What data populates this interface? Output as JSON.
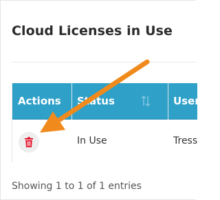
{
  "card": {
    "title": "Cloud Licenses in Use"
  },
  "table": {
    "columns": [
      "Actions",
      "Status",
      "User"
    ],
    "rows": [
      {
        "status": "In Use",
        "user": "Tress"
      }
    ]
  },
  "footer": {
    "info": "Showing 1 to 1 of 1 entries"
  },
  "icons": {
    "delete": "trash-icon",
    "sort": "sort-icon",
    "annotation": "arrow-annotation"
  },
  "colors": {
    "header_bg": "#2fa0c8",
    "delete_icon": "#e3122a",
    "arrow": "#f08a1c"
  }
}
